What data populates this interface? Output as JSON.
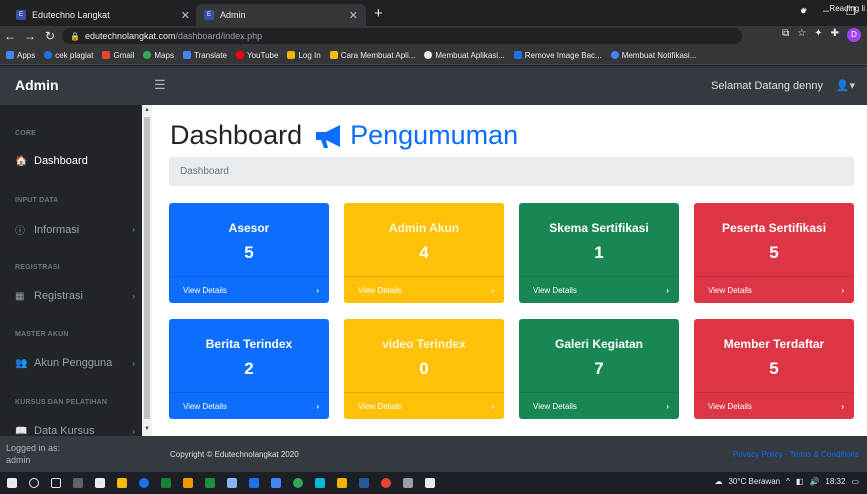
{
  "browser": {
    "tabs": [
      {
        "title": "Edutechno Langkat",
        "active": false
      },
      {
        "title": "Admin",
        "active": true
      }
    ],
    "new_tab": "+",
    "url_domain": "edutechnolangkat.com",
    "url_path": "/dashboard/index.php",
    "profile_initial": "D",
    "bookmarks": [
      {
        "label": "Apps",
        "color": "#4285f4"
      },
      {
        "label": "cek plagiat",
        "color": "#1a73e8"
      },
      {
        "label": "Gmail",
        "color": "#ea4335"
      },
      {
        "label": "Maps",
        "color": "#34a853"
      },
      {
        "label": "Translate",
        "color": "#4285f4"
      },
      {
        "label": "YouTube",
        "color": "#ff0000"
      },
      {
        "label": "Log In",
        "color": "#f4b400"
      },
      {
        "label": "Cara Membuat Apli...",
        "color": "#fbbc04"
      },
      {
        "label": "Membuat Aplikasi...",
        "color": "#e8eaed"
      },
      {
        "label": "Remove Image Bac...",
        "color": "#1a73e8"
      },
      {
        "label": "Membuat Notifikasi...",
        "color": "#4285f4"
      }
    ],
    "bookmarks_more": "»",
    "reading_list": "Reading li"
  },
  "navbar": {
    "brand": "Admin",
    "greeting": "Selamat Datang denny"
  },
  "sidebar": {
    "sections": [
      {
        "heading": "CORE",
        "item": {
          "label": "Dashboard",
          "icon": "tachometer-icon",
          "active": true,
          "has_arrow": false
        }
      },
      {
        "heading": "INPUT DATA",
        "item": {
          "label": "Informasi",
          "icon": "info-circle-icon",
          "active": false,
          "has_arrow": true
        }
      },
      {
        "heading": "REGISTRASI",
        "item": {
          "label": "Registrasi",
          "icon": "table-icon",
          "active": false,
          "has_arrow": true
        }
      },
      {
        "heading": "MASTER AKUN",
        "item": {
          "label": "Akun Pengguna",
          "icon": "users-icon",
          "active": false,
          "has_arrow": true
        }
      },
      {
        "heading": "KURSUS DAN PELATIHAN",
        "item": {
          "label": "Data Kursus",
          "icon": "book-icon",
          "active": false,
          "has_arrow": true
        }
      }
    ],
    "footer_label": "Logged in as:",
    "footer_user": "admin"
  },
  "main": {
    "title": "Dashboard",
    "subtitle": "Pengumuman",
    "breadcrumb": "Dashboard",
    "cards": [
      {
        "title": "Asesor",
        "value": "5",
        "link": "View Details",
        "color": "blue"
      },
      {
        "title": "Admin Akun",
        "value": "4",
        "link": "View Details",
        "color": "yellow"
      },
      {
        "title": "Skema Sertifikasi",
        "value": "1",
        "link": "View Details",
        "color": "green"
      },
      {
        "title": "Peserta Sertifikasi",
        "value": "5",
        "link": "View Details",
        "color": "red"
      },
      {
        "title": "Berita Terindex",
        "value": "2",
        "link": "View Details",
        "color": "blue"
      },
      {
        "title": "video Terindex",
        "value": "0",
        "link": "View Details",
        "color": "yellow"
      },
      {
        "title": "Galeri Kegiatan",
        "value": "7",
        "link": "View Details",
        "color": "green"
      },
      {
        "title": "Member Terdaftar",
        "value": "5",
        "link": "View Details",
        "color": "red"
      }
    ]
  },
  "footer": {
    "copyright": "Copyright © Edutechnolangkat 2020",
    "links": "Privacy Policy · Terms & Conditions"
  },
  "taskbar": {
    "weather": "30°C Berawan",
    "time": "18:32"
  }
}
